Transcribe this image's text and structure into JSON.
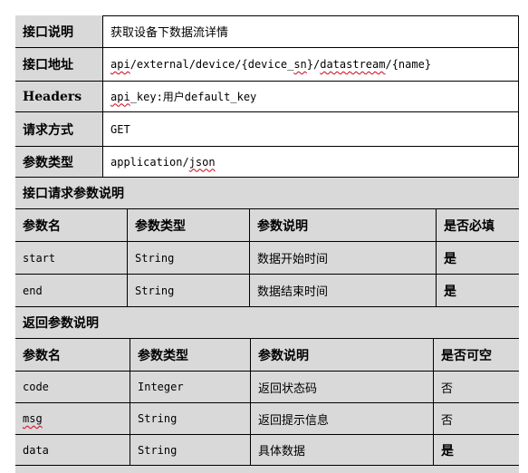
{
  "info": {
    "desc_label": "接口说明",
    "desc_value": "获取设备下数据流详情",
    "addr_label": "接口地址",
    "addr_parts": [
      "api",
      "/external/device/{device_",
      "sn",
      "}/",
      "datastream",
      "/{name}"
    ],
    "headers_label": "Headers",
    "headers_key": "api",
    "headers_rest": "_key:用户default_key",
    "method_label": "请求方式",
    "method_value": "GET",
    "ctype_label": "参数类型",
    "ctype_prefix": "application/",
    "ctype_suffix": "json"
  },
  "request": {
    "title": "接口请求参数说明",
    "headers": [
      "参数名",
      "参数类型",
      "参数说明",
      "是否必填"
    ],
    "rows": [
      [
        "start",
        "String",
        "数据开始时间",
        "是"
      ],
      [
        "end",
        "String",
        "数据结束时间",
        "是"
      ]
    ]
  },
  "response": {
    "title": "返回参数说明",
    "headers": [
      "参数名",
      "参数类型",
      "参数说明",
      "是否可空"
    ],
    "rows": [
      [
        "code",
        "Integer",
        "返回状态码",
        "否"
      ],
      [
        "msg",
        "String",
        "返回提示信息",
        "否"
      ],
      [
        "data",
        "String",
        "具体数据",
        "是"
      ]
    ]
  }
}
